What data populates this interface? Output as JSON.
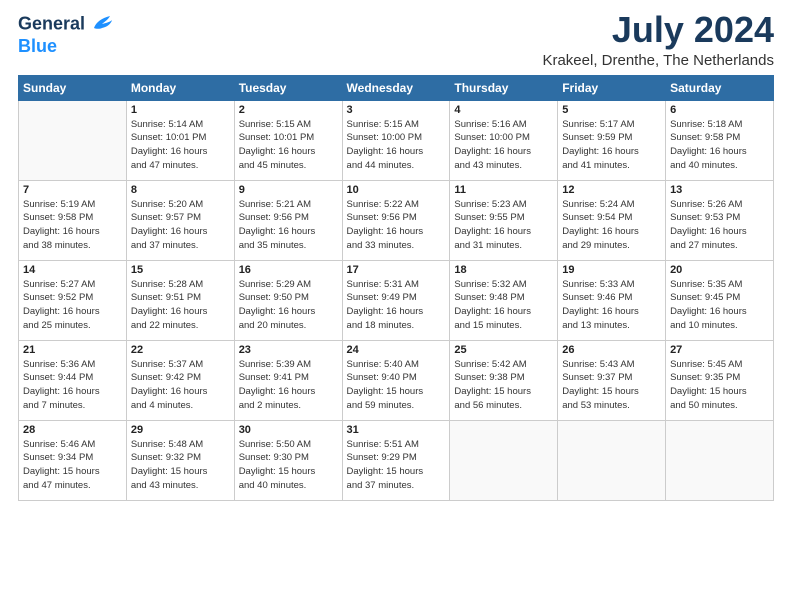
{
  "logo": {
    "general": "General",
    "blue": "Blue"
  },
  "header": {
    "month": "July 2024",
    "location": "Krakeel, Drenthe, The Netherlands"
  },
  "weekdays": [
    "Sunday",
    "Monday",
    "Tuesday",
    "Wednesday",
    "Thursday",
    "Friday",
    "Saturday"
  ],
  "weeks": [
    [
      {
        "day": "",
        "info": ""
      },
      {
        "day": "1",
        "info": "Sunrise: 5:14 AM\nSunset: 10:01 PM\nDaylight: 16 hours\nand 47 minutes."
      },
      {
        "day": "2",
        "info": "Sunrise: 5:15 AM\nSunset: 10:01 PM\nDaylight: 16 hours\nand 45 minutes."
      },
      {
        "day": "3",
        "info": "Sunrise: 5:15 AM\nSunset: 10:00 PM\nDaylight: 16 hours\nand 44 minutes."
      },
      {
        "day": "4",
        "info": "Sunrise: 5:16 AM\nSunset: 10:00 PM\nDaylight: 16 hours\nand 43 minutes."
      },
      {
        "day": "5",
        "info": "Sunrise: 5:17 AM\nSunset: 9:59 PM\nDaylight: 16 hours\nand 41 minutes."
      },
      {
        "day": "6",
        "info": "Sunrise: 5:18 AM\nSunset: 9:58 PM\nDaylight: 16 hours\nand 40 minutes."
      }
    ],
    [
      {
        "day": "7",
        "info": "Sunrise: 5:19 AM\nSunset: 9:58 PM\nDaylight: 16 hours\nand 38 minutes."
      },
      {
        "day": "8",
        "info": "Sunrise: 5:20 AM\nSunset: 9:57 PM\nDaylight: 16 hours\nand 37 minutes."
      },
      {
        "day": "9",
        "info": "Sunrise: 5:21 AM\nSunset: 9:56 PM\nDaylight: 16 hours\nand 35 minutes."
      },
      {
        "day": "10",
        "info": "Sunrise: 5:22 AM\nSunset: 9:56 PM\nDaylight: 16 hours\nand 33 minutes."
      },
      {
        "day": "11",
        "info": "Sunrise: 5:23 AM\nSunset: 9:55 PM\nDaylight: 16 hours\nand 31 minutes."
      },
      {
        "day": "12",
        "info": "Sunrise: 5:24 AM\nSunset: 9:54 PM\nDaylight: 16 hours\nand 29 minutes."
      },
      {
        "day": "13",
        "info": "Sunrise: 5:26 AM\nSunset: 9:53 PM\nDaylight: 16 hours\nand 27 minutes."
      }
    ],
    [
      {
        "day": "14",
        "info": "Sunrise: 5:27 AM\nSunset: 9:52 PM\nDaylight: 16 hours\nand 25 minutes."
      },
      {
        "day": "15",
        "info": "Sunrise: 5:28 AM\nSunset: 9:51 PM\nDaylight: 16 hours\nand 22 minutes."
      },
      {
        "day": "16",
        "info": "Sunrise: 5:29 AM\nSunset: 9:50 PM\nDaylight: 16 hours\nand 20 minutes."
      },
      {
        "day": "17",
        "info": "Sunrise: 5:31 AM\nSunset: 9:49 PM\nDaylight: 16 hours\nand 18 minutes."
      },
      {
        "day": "18",
        "info": "Sunrise: 5:32 AM\nSunset: 9:48 PM\nDaylight: 16 hours\nand 15 minutes."
      },
      {
        "day": "19",
        "info": "Sunrise: 5:33 AM\nSunset: 9:46 PM\nDaylight: 16 hours\nand 13 minutes."
      },
      {
        "day": "20",
        "info": "Sunrise: 5:35 AM\nSunset: 9:45 PM\nDaylight: 16 hours\nand 10 minutes."
      }
    ],
    [
      {
        "day": "21",
        "info": "Sunrise: 5:36 AM\nSunset: 9:44 PM\nDaylight: 16 hours\nand 7 minutes."
      },
      {
        "day": "22",
        "info": "Sunrise: 5:37 AM\nSunset: 9:42 PM\nDaylight: 16 hours\nand 4 minutes."
      },
      {
        "day": "23",
        "info": "Sunrise: 5:39 AM\nSunset: 9:41 PM\nDaylight: 16 hours\nand 2 minutes."
      },
      {
        "day": "24",
        "info": "Sunrise: 5:40 AM\nSunset: 9:40 PM\nDaylight: 15 hours\nand 59 minutes."
      },
      {
        "day": "25",
        "info": "Sunrise: 5:42 AM\nSunset: 9:38 PM\nDaylight: 15 hours\nand 56 minutes."
      },
      {
        "day": "26",
        "info": "Sunrise: 5:43 AM\nSunset: 9:37 PM\nDaylight: 15 hours\nand 53 minutes."
      },
      {
        "day": "27",
        "info": "Sunrise: 5:45 AM\nSunset: 9:35 PM\nDaylight: 15 hours\nand 50 minutes."
      }
    ],
    [
      {
        "day": "28",
        "info": "Sunrise: 5:46 AM\nSunset: 9:34 PM\nDaylight: 15 hours\nand 47 minutes."
      },
      {
        "day": "29",
        "info": "Sunrise: 5:48 AM\nSunset: 9:32 PM\nDaylight: 15 hours\nand 43 minutes."
      },
      {
        "day": "30",
        "info": "Sunrise: 5:50 AM\nSunset: 9:30 PM\nDaylight: 15 hours\nand 40 minutes."
      },
      {
        "day": "31",
        "info": "Sunrise: 5:51 AM\nSunset: 9:29 PM\nDaylight: 15 hours\nand 37 minutes."
      },
      {
        "day": "",
        "info": ""
      },
      {
        "day": "",
        "info": ""
      },
      {
        "day": "",
        "info": ""
      }
    ]
  ]
}
